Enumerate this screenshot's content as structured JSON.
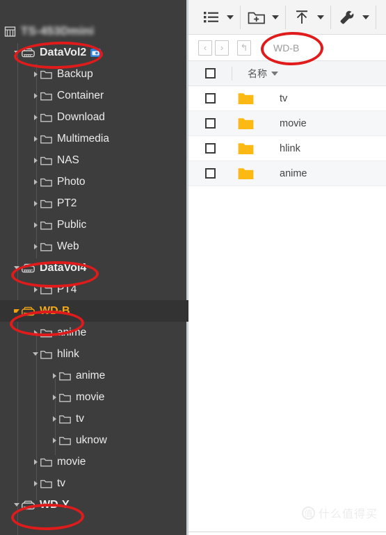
{
  "sidebar": {
    "host": {
      "name": "TS-453Dmini",
      "icon": "server-rack-icon",
      "censored": true
    },
    "tree": [
      {
        "label": "DataVol2",
        "type": "volume",
        "level": 0,
        "expanded": true,
        "badge": "snapshot-badge",
        "highlighted": false,
        "annotated": true
      },
      {
        "label": "Backup",
        "type": "folder",
        "level": 1,
        "expanded": false
      },
      {
        "label": "Container",
        "type": "folder",
        "level": 1,
        "expanded": false
      },
      {
        "label": "Download",
        "type": "folder",
        "level": 1,
        "expanded": false
      },
      {
        "label": "Multimedia",
        "type": "folder",
        "level": 1,
        "expanded": false
      },
      {
        "label": "NAS",
        "type": "folder",
        "level": 1,
        "expanded": false
      },
      {
        "label": "Photo",
        "type": "folder",
        "level": 1,
        "expanded": false
      },
      {
        "label": "PT2",
        "type": "folder",
        "level": 1,
        "expanded": false
      },
      {
        "label": "Public",
        "type": "folder",
        "level": 1,
        "expanded": false
      },
      {
        "label": "Web",
        "type": "folder",
        "level": 1,
        "expanded": false
      },
      {
        "label": "DataVol4",
        "type": "volume",
        "level": 0,
        "expanded": true,
        "annotated": true
      },
      {
        "label": "PT4",
        "type": "folder",
        "level": 1,
        "expanded": false
      },
      {
        "label": "WD-B",
        "type": "volume",
        "level": 0,
        "expanded": true,
        "selected": true,
        "annotated": true
      },
      {
        "label": "anime",
        "type": "folder",
        "level": 1,
        "expanded": false
      },
      {
        "label": "hlink",
        "type": "folder",
        "level": 1,
        "expanded": true
      },
      {
        "label": "anime",
        "type": "folder",
        "level": 2,
        "expanded": false
      },
      {
        "label": "movie",
        "type": "folder",
        "level": 2,
        "expanded": false
      },
      {
        "label": "tv",
        "type": "folder",
        "level": 2,
        "expanded": false
      },
      {
        "label": "uknow",
        "type": "folder",
        "level": 2,
        "expanded": false
      },
      {
        "label": "movie",
        "type": "folder",
        "level": 1,
        "expanded": false
      },
      {
        "label": "tv",
        "type": "folder",
        "level": 1,
        "expanded": false
      },
      {
        "label": "WD-Y",
        "type": "volume",
        "level": 0,
        "expanded": true,
        "annotated": true
      }
    ]
  },
  "toolbar": {
    "groups": [
      {
        "icon": "list-view-icon",
        "name": "view-mode-button",
        "has_caret": true
      },
      {
        "icon": "new-folder-icon",
        "name": "new-folder-button",
        "has_caret": true
      },
      {
        "icon": "upload-icon",
        "name": "upload-button",
        "has_caret": true
      },
      {
        "icon": "wrench-icon",
        "name": "tools-button",
        "has_caret": true
      }
    ]
  },
  "navbar": {
    "back_label": "‹",
    "forward_label": "›",
    "up_label": "↰",
    "breadcrumb": "WD-B",
    "annotated": true
  },
  "file_list": {
    "columns": {
      "name_header": "名称",
      "sort_direction": "desc"
    },
    "rows": [
      {
        "name": "tv",
        "icon": "folder-icon",
        "checked": false
      },
      {
        "name": "movie",
        "icon": "folder-icon",
        "checked": false
      },
      {
        "name": "hlink",
        "icon": "folder-icon",
        "checked": false
      },
      {
        "name": "anime",
        "icon": "folder-icon",
        "checked": false
      }
    ]
  },
  "watermark": {
    "mark": "值",
    "text": "什么值得买"
  },
  "colors": {
    "sidebar_bg": "#3d3d3d",
    "sidebar_selected_bg": "#333333",
    "selected_text": "#f3a712",
    "folder_yellow": "#fcb813",
    "annotation_red": "#e01b1b",
    "panel_bg": "#ffffff",
    "toolbar_bg": "#f4f4f4"
  }
}
